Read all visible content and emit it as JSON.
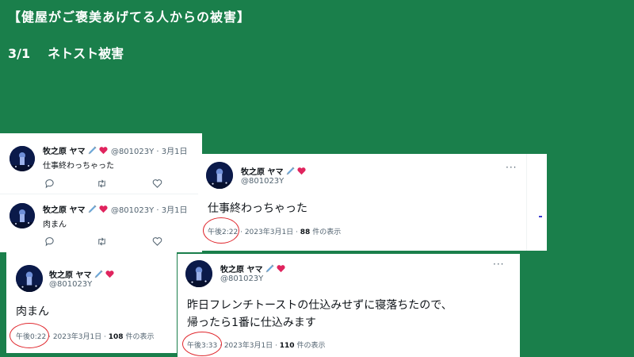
{
  "header": {
    "title": "【健屋がご褒美あげてる人からの被害】",
    "date": "3/1",
    "subtitle": "ネトスト被害"
  },
  "user": {
    "display_name": "牧之原 ヤマ",
    "handle": "@801023Y"
  },
  "timeline": {
    "items": [
      {
        "meta": "@801023Y · 3月1日",
        "text": "仕事終わっちゃった"
      },
      {
        "meta": "@801023Y · 3月1日",
        "text": "肉まん"
      }
    ]
  },
  "tweets": [
    {
      "text": "仕事終わっちゃった",
      "time": "午後2:22",
      "date": "· 2023年3月1日 ·",
      "views": "88",
      "views_label": "件の表示"
    },
    {
      "text": "肉まん",
      "time": "午後0:22",
      "date": "· 2023年3月1日 ·",
      "views": "108",
      "views_label": "件の表示"
    },
    {
      "text_line1": "昨日フレンチトーストの仕込みせずに寝落ちたので、",
      "text_line2": "帰ったら1番に仕込みます",
      "time": "午後3:33",
      "date": "· 2023年3月1日 ·",
      "views": "110",
      "views_label": "件の表示"
    }
  ],
  "colors": {
    "background": "#1a7f4b",
    "highlight_circle": "#e0282e",
    "heart": "#e0245e",
    "text_secondary": "#536471"
  },
  "icons": [
    "syringe-icon",
    "heart-icon",
    "reply-icon",
    "retweet-icon",
    "like-icon",
    "more-icon"
  ]
}
